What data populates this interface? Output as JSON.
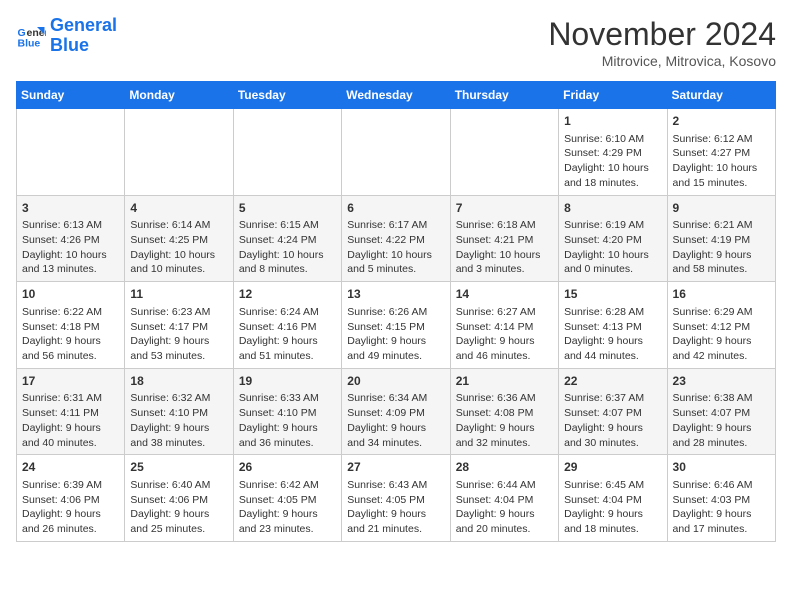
{
  "header": {
    "logo_general": "General",
    "logo_blue": "Blue",
    "month_title": "November 2024",
    "location": "Mitrovice, Mitrovica, Kosovo"
  },
  "days_of_week": [
    "Sunday",
    "Monday",
    "Tuesday",
    "Wednesday",
    "Thursday",
    "Friday",
    "Saturday"
  ],
  "weeks": [
    [
      {
        "day": "",
        "info": ""
      },
      {
        "day": "",
        "info": ""
      },
      {
        "day": "",
        "info": ""
      },
      {
        "day": "",
        "info": ""
      },
      {
        "day": "",
        "info": ""
      },
      {
        "day": "1",
        "info": "Sunrise: 6:10 AM\nSunset: 4:29 PM\nDaylight: 10 hours\nand 18 minutes."
      },
      {
        "day": "2",
        "info": "Sunrise: 6:12 AM\nSunset: 4:27 PM\nDaylight: 10 hours\nand 15 minutes."
      }
    ],
    [
      {
        "day": "3",
        "info": "Sunrise: 6:13 AM\nSunset: 4:26 PM\nDaylight: 10 hours\nand 13 minutes."
      },
      {
        "day": "4",
        "info": "Sunrise: 6:14 AM\nSunset: 4:25 PM\nDaylight: 10 hours\nand 10 minutes."
      },
      {
        "day": "5",
        "info": "Sunrise: 6:15 AM\nSunset: 4:24 PM\nDaylight: 10 hours\nand 8 minutes."
      },
      {
        "day": "6",
        "info": "Sunrise: 6:17 AM\nSunset: 4:22 PM\nDaylight: 10 hours\nand 5 minutes."
      },
      {
        "day": "7",
        "info": "Sunrise: 6:18 AM\nSunset: 4:21 PM\nDaylight: 10 hours\nand 3 minutes."
      },
      {
        "day": "8",
        "info": "Sunrise: 6:19 AM\nSunset: 4:20 PM\nDaylight: 10 hours\nand 0 minutes."
      },
      {
        "day": "9",
        "info": "Sunrise: 6:21 AM\nSunset: 4:19 PM\nDaylight: 9 hours\nand 58 minutes."
      }
    ],
    [
      {
        "day": "10",
        "info": "Sunrise: 6:22 AM\nSunset: 4:18 PM\nDaylight: 9 hours\nand 56 minutes."
      },
      {
        "day": "11",
        "info": "Sunrise: 6:23 AM\nSunset: 4:17 PM\nDaylight: 9 hours\nand 53 minutes."
      },
      {
        "day": "12",
        "info": "Sunrise: 6:24 AM\nSunset: 4:16 PM\nDaylight: 9 hours\nand 51 minutes."
      },
      {
        "day": "13",
        "info": "Sunrise: 6:26 AM\nSunset: 4:15 PM\nDaylight: 9 hours\nand 49 minutes."
      },
      {
        "day": "14",
        "info": "Sunrise: 6:27 AM\nSunset: 4:14 PM\nDaylight: 9 hours\nand 46 minutes."
      },
      {
        "day": "15",
        "info": "Sunrise: 6:28 AM\nSunset: 4:13 PM\nDaylight: 9 hours\nand 44 minutes."
      },
      {
        "day": "16",
        "info": "Sunrise: 6:29 AM\nSunset: 4:12 PM\nDaylight: 9 hours\nand 42 minutes."
      }
    ],
    [
      {
        "day": "17",
        "info": "Sunrise: 6:31 AM\nSunset: 4:11 PM\nDaylight: 9 hours\nand 40 minutes."
      },
      {
        "day": "18",
        "info": "Sunrise: 6:32 AM\nSunset: 4:10 PM\nDaylight: 9 hours\nand 38 minutes."
      },
      {
        "day": "19",
        "info": "Sunrise: 6:33 AM\nSunset: 4:10 PM\nDaylight: 9 hours\nand 36 minutes."
      },
      {
        "day": "20",
        "info": "Sunrise: 6:34 AM\nSunset: 4:09 PM\nDaylight: 9 hours\nand 34 minutes."
      },
      {
        "day": "21",
        "info": "Sunrise: 6:36 AM\nSunset: 4:08 PM\nDaylight: 9 hours\nand 32 minutes."
      },
      {
        "day": "22",
        "info": "Sunrise: 6:37 AM\nSunset: 4:07 PM\nDaylight: 9 hours\nand 30 minutes."
      },
      {
        "day": "23",
        "info": "Sunrise: 6:38 AM\nSunset: 4:07 PM\nDaylight: 9 hours\nand 28 minutes."
      }
    ],
    [
      {
        "day": "24",
        "info": "Sunrise: 6:39 AM\nSunset: 4:06 PM\nDaylight: 9 hours\nand 26 minutes."
      },
      {
        "day": "25",
        "info": "Sunrise: 6:40 AM\nSunset: 4:06 PM\nDaylight: 9 hours\nand 25 minutes."
      },
      {
        "day": "26",
        "info": "Sunrise: 6:42 AM\nSunset: 4:05 PM\nDaylight: 9 hours\nand 23 minutes."
      },
      {
        "day": "27",
        "info": "Sunrise: 6:43 AM\nSunset: 4:05 PM\nDaylight: 9 hours\nand 21 minutes."
      },
      {
        "day": "28",
        "info": "Sunrise: 6:44 AM\nSunset: 4:04 PM\nDaylight: 9 hours\nand 20 minutes."
      },
      {
        "day": "29",
        "info": "Sunrise: 6:45 AM\nSunset: 4:04 PM\nDaylight: 9 hours\nand 18 minutes."
      },
      {
        "day": "30",
        "info": "Sunrise: 6:46 AM\nSunset: 4:03 PM\nDaylight: 9 hours\nand 17 minutes."
      }
    ]
  ]
}
